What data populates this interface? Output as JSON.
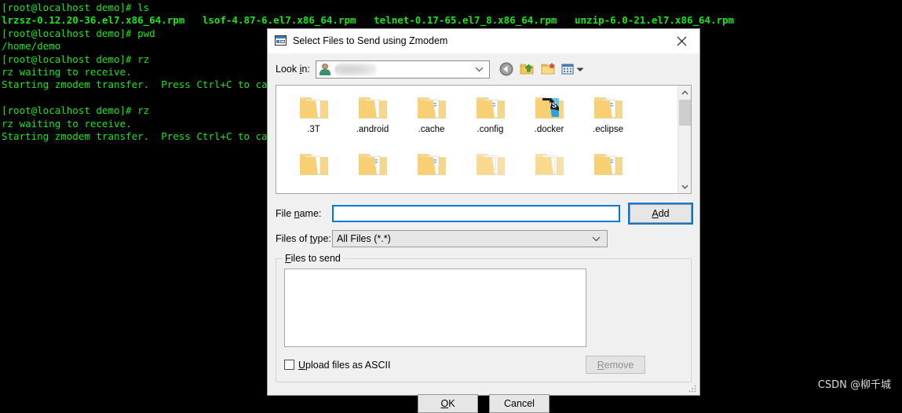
{
  "terminal": {
    "lines": [
      {
        "text": "[root@localhost demo]# ls",
        "bold": false
      },
      {
        "text": "lrzsz-0.12.20-36.el7.x86_64.rpm   lsof-4.87-6.el7.x86_64.rpm   telnet-0.17-65.el7_8.x86_64.rpm   unzip-6.0-21.el7.x86_64.rpm",
        "bold": true
      },
      {
        "text": "[root@localhost demo]# pwd",
        "bold": false
      },
      {
        "text": "/home/demo",
        "bold": false
      },
      {
        "text": "[root@localhost demo]# rz",
        "bold": false
      },
      {
        "text": "rz waiting to receive.",
        "bold": false
      },
      {
        "text": "Starting zmodem transfer.  Press Ctrl+C to cancel.",
        "bold": false
      },
      {
        "text": "",
        "bold": false
      },
      {
        "text": "[root@localhost demo]# rz",
        "bold": false
      },
      {
        "text": "rz waiting to receive.",
        "bold": false
      },
      {
        "text": "Starting zmodem transfer.  Press Ctrl+C to cancel.",
        "bold": false
      }
    ],
    "foreground_color": "#19e619",
    "background_color": "#000000"
  },
  "dialog": {
    "title": "Select Files to Send using Zmodem",
    "title_icon": "zmodem-window-icon",
    "close_icon": "close-icon",
    "lookin": {
      "label": "Look in:",
      "label_accel": "i",
      "value": "",
      "value_redacted": true,
      "avatar_icon": "user-avatar-icon",
      "dropdown_icon": "chevron-down-icon"
    },
    "toolbar": [
      {
        "name": "back-button",
        "icon": "back-arrow-icon"
      },
      {
        "name": "up-one-level-button",
        "icon": "folder-up-arrow-icon"
      },
      {
        "name": "new-folder-button",
        "icon": "new-folder-icon"
      },
      {
        "name": "view-menu-button",
        "icon": "view-grid-icon"
      }
    ],
    "filelist": {
      "items": [
        {
          "label": ".3T",
          "icon": "folder-icon",
          "variant": "plain"
        },
        {
          "label": ".android",
          "icon": "folder-icon",
          "variant": "plain"
        },
        {
          "label": ".cache",
          "icon": "folder-icon",
          "variant": "docs"
        },
        {
          "label": ".config",
          "icon": "folder-icon",
          "variant": "docs"
        },
        {
          "label": ".docker",
          "icon": "folder-wsl-icon",
          "variant": "wsl"
        },
        {
          "label": ".eclipse",
          "icon": "folder-icon",
          "variant": "docs"
        }
      ],
      "partial_row": [
        {
          "variant": "plain"
        },
        {
          "variant": "docs"
        },
        {
          "variant": "docs"
        },
        {
          "variant": "papers"
        },
        {
          "variant": "papers"
        },
        {
          "variant": "docs"
        }
      ],
      "scrollbar": {
        "up_icon": "chevron-up-icon",
        "down_icon": "chevron-down-icon"
      }
    },
    "filename": {
      "label": "File name:",
      "label_accel": "n",
      "value": "",
      "placeholder": ""
    },
    "add_button": {
      "label": "Add",
      "accel": "A",
      "focused": true
    },
    "filetype": {
      "label": "Files of type:",
      "label_accel": "t",
      "value": "All Files (*.*)",
      "options": [
        "All Files (*.*)"
      ],
      "dropdown_icon": "chevron-down-icon"
    },
    "files_to_send": {
      "group_label": "Files to send",
      "group_accel": "F",
      "items": [],
      "ascii_checkbox": {
        "label": "Upload files as ASCII",
        "accel": "U",
        "checked": false
      },
      "remove_button": {
        "label": "Remove",
        "accel": "R",
        "disabled": true
      }
    },
    "footer": {
      "ok_label": "OK",
      "ok_accel": "O",
      "cancel_label": "Cancel"
    },
    "resize_grip_icon": "resize-grip-icon"
  },
  "watermark": {
    "text": "CSDN @柳千城"
  }
}
